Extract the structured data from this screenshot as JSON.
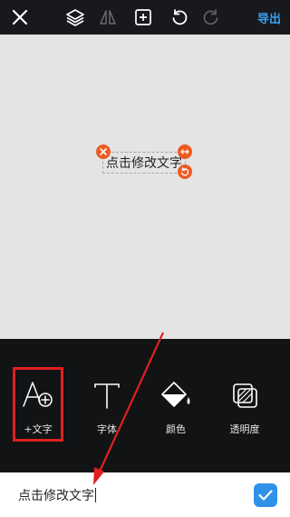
{
  "topbar": {
    "icons": [
      "close-icon",
      "layers-icon",
      "flip-icon",
      "add-layer-icon",
      "undo-icon",
      "redo-icon"
    ],
    "export_label": "导出"
  },
  "canvas": {
    "text": "点击修改文字"
  },
  "toolbar": {
    "tools": [
      {
        "label": "+文字",
        "icon": "add-text-icon"
      },
      {
        "label": "字体",
        "icon": "font-icon"
      },
      {
        "label": "颜色",
        "icon": "paint-bucket-icon"
      },
      {
        "label": "透明度",
        "icon": "opacity-icon"
      }
    ]
  },
  "input": {
    "value": "点击修改文字"
  },
  "colors": {
    "accent": "#3aa0ee",
    "handle": "#ee5a21",
    "annotation": "#e02020"
  }
}
